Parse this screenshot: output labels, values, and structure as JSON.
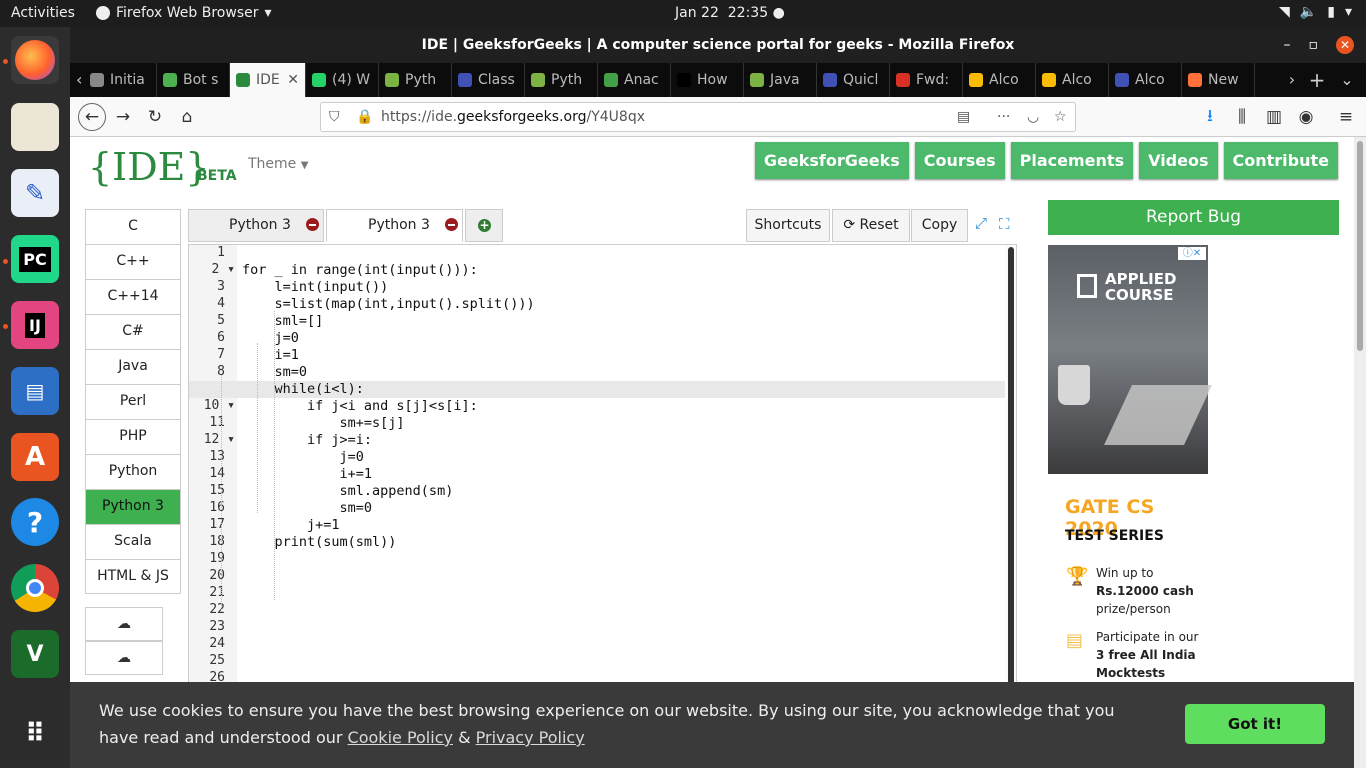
{
  "topbar": {
    "activities": "Activities",
    "app": "Firefox Web Browser",
    "date": "Jan 22",
    "time": "22:35"
  },
  "window": {
    "title": "IDE | GeeksforGeeks | A computer science portal for geeks - Mozilla Firefox"
  },
  "tabs": [
    {
      "label": "Initia",
      "color": "#888888"
    },
    {
      "label": "Bot s",
      "color": "#4caf50"
    },
    {
      "label": "IDE",
      "color": "#2b8a3e"
    },
    {
      "label": "(4) W",
      "color": "#25d366"
    },
    {
      "label": "Pyth",
      "color": "#7cb342"
    },
    {
      "label": "Class",
      "color": "#3f51b5"
    },
    {
      "label": "Pyth",
      "color": "#7cb342"
    },
    {
      "label": "Anac",
      "color": "#43a047"
    },
    {
      "label": "How",
      "color": "#000000"
    },
    {
      "label": "Java",
      "color": "#7cb342"
    },
    {
      "label": "Quicl",
      "color": "#3f51b5"
    },
    {
      "label": "Fwd:",
      "color": "#d93025"
    },
    {
      "label": "Alco",
      "color": "#fbbc04"
    },
    {
      "label": "Alco",
      "color": "#fbbc04"
    },
    {
      "label": "Alco",
      "color": "#3f51b5"
    },
    {
      "label": "New",
      "color": "#ff7139"
    }
  ],
  "url": {
    "prefix": "https://ide.",
    "host": "geeksforgeeks.org",
    "path": "/Y4U8qx"
  },
  "site": {
    "logo": "{IDE}",
    "beta": "BETA",
    "theme": "Theme",
    "nav": [
      "GeeksforGeeks",
      "Courses",
      "Placements",
      "Videos",
      "Contribute"
    ]
  },
  "languages": [
    "C",
    "C++",
    "C++14",
    "C#",
    "Java",
    "Perl",
    "PHP",
    "Python",
    "Python 3",
    "Scala",
    "HTML & JS"
  ],
  "selected_language": "Python 3",
  "editor_tabs": [
    "Python 3",
    "Python 3"
  ],
  "toolbar": {
    "shortcuts": "Shortcuts",
    "reset": "Reset",
    "copy": "Copy"
  },
  "code": [
    "",
    "for _ in range(int(input())):",
    "    l=int(input())",
    "    s=list(map(int,input().split()))",
    "    sml=[]",
    "    j=0",
    "    i=1",
    "    sm=0",
    "    while(i<l):",
    "        if j<i and s[j]<s[i]:",
    "            sm+=s[j]",
    "        if j>=i:",
    "            j=0",
    "            i+=1",
    "            sml.append(sm)",
    "            sm=0",
    "        j+=1",
    "    print(sum(sml))",
    "",
    "",
    "",
    "",
    "",
    "",
    "",
    ""
  ],
  "report_bug": "Report Bug",
  "ad": {
    "brand_line1": "APPLIED",
    "brand_line2": "COURSE",
    "gate": "GATE CS 2020",
    "test_series": "TEST SERIES",
    "win_line1": "Win up to",
    "win_line2": "Rs.12000 cash",
    "win_line3": "prize/person",
    "part_line1": "Participate in our",
    "part_line2": "3 free All India",
    "part_line3": "Mocktests"
  },
  "cookie": {
    "message": "We use cookies to ensure you have the best browsing experience on our website. By using our site, you acknowledge that you have read and understood our",
    "cookie_policy": "Cookie Policy",
    "amp": "&",
    "privacy_policy": "Privacy Policy",
    "button": "Got it!"
  }
}
